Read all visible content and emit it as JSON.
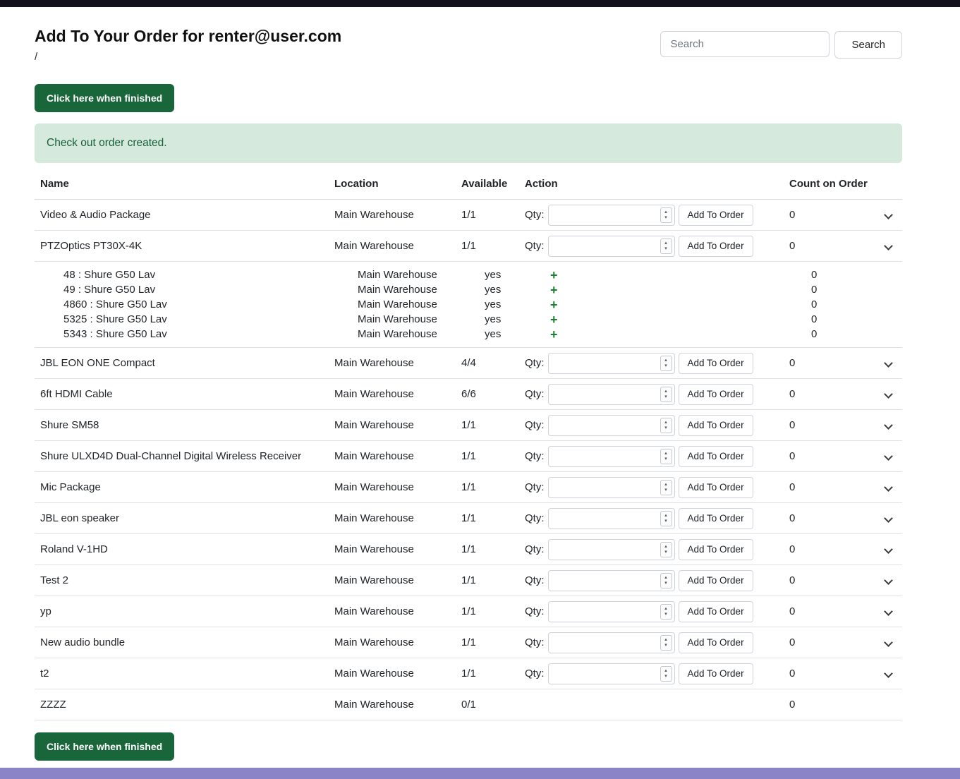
{
  "page": {
    "title": "Add To Your Order for renter@user.com",
    "breadcrumb": "/",
    "finish_button_label": "Click here when finished",
    "alert_message": "Check out order created."
  },
  "search": {
    "placeholder": "Search",
    "button_label": "Search"
  },
  "table": {
    "headers": [
      "Name",
      "Location",
      "Available",
      "Action",
      "Count on Order"
    ],
    "qty_label": "Qty:",
    "add_button_label": "Add To Order",
    "rows": [
      {
        "name": "Video & Audio Package",
        "location": "Main Warehouse",
        "available": "1/1",
        "count": "0",
        "has_action": true,
        "has_chevron": true
      },
      {
        "name": "PTZOptics PT30X-4K",
        "location": "Main Warehouse",
        "available": "1/1",
        "count": "0",
        "has_action": true,
        "has_chevron": true,
        "children": [
          {
            "name": "48 : Shure G50 Lav",
            "location": "Main Warehouse",
            "available": "yes",
            "count": "0"
          },
          {
            "name": "49 : Shure G50 Lav",
            "location": "Main Warehouse",
            "available": "yes",
            "count": "0"
          },
          {
            "name": "4860 : Shure G50 Lav",
            "location": "Main Warehouse",
            "available": "yes",
            "count": "0"
          },
          {
            "name": "5325 : Shure G50 Lav",
            "location": "Main Warehouse",
            "available": "yes",
            "count": "0"
          },
          {
            "name": "5343 : Shure G50 Lav",
            "location": "Main Warehouse",
            "available": "yes",
            "count": "0"
          }
        ]
      },
      {
        "name": "JBL EON ONE Compact",
        "location": "Main Warehouse",
        "available": "4/4",
        "count": "0",
        "has_action": true,
        "has_chevron": true
      },
      {
        "name": "6ft HDMI Cable",
        "location": "Main Warehouse",
        "available": "6/6",
        "count": "0",
        "has_action": true,
        "has_chevron": true
      },
      {
        "name": "Shure SM58",
        "location": "Main Warehouse",
        "available": "1/1",
        "count": "0",
        "has_action": true,
        "has_chevron": true
      },
      {
        "name": "Shure ULXD4D Dual-Channel Digital Wireless Receiver",
        "location": "Main Warehouse",
        "available": "1/1",
        "count": "0",
        "has_action": true,
        "has_chevron": true
      },
      {
        "name": "Mic Package",
        "location": "Main Warehouse",
        "available": "1/1",
        "count": "0",
        "has_action": true,
        "has_chevron": true
      },
      {
        "name": "JBL eon speaker",
        "location": "Main Warehouse",
        "available": "1/1",
        "count": "0",
        "has_action": true,
        "has_chevron": true
      },
      {
        "name": "Roland V-1HD",
        "location": "Main Warehouse",
        "available": "1/1",
        "count": "0",
        "has_action": true,
        "has_chevron": true
      },
      {
        "name": "Test 2",
        "location": "Main Warehouse",
        "available": "1/1",
        "count": "0",
        "has_action": true,
        "has_chevron": true
      },
      {
        "name": "yp",
        "location": "Main Warehouse",
        "available": "1/1",
        "count": "0",
        "has_action": true,
        "has_chevron": true
      },
      {
        "name": "New audio bundle",
        "location": "Main Warehouse",
        "available": "1/1",
        "count": "0",
        "has_action": true,
        "has_chevron": true
      },
      {
        "name": "t2",
        "location": "Main Warehouse",
        "available": "1/1",
        "count": "0",
        "has_action": true,
        "has_chevron": true
      },
      {
        "name": "ZZZZ",
        "location": "Main Warehouse",
        "available": "0/1",
        "count": "0",
        "has_action": false,
        "has_chevron": false
      }
    ]
  },
  "colors": {
    "primary_button": "#186639",
    "alert_bg": "#d6e9dd",
    "alert_text": "#17603a",
    "plus_green": "#1e7e34",
    "top_bar": "#13111c",
    "footer_strip": "#8b84c7"
  }
}
